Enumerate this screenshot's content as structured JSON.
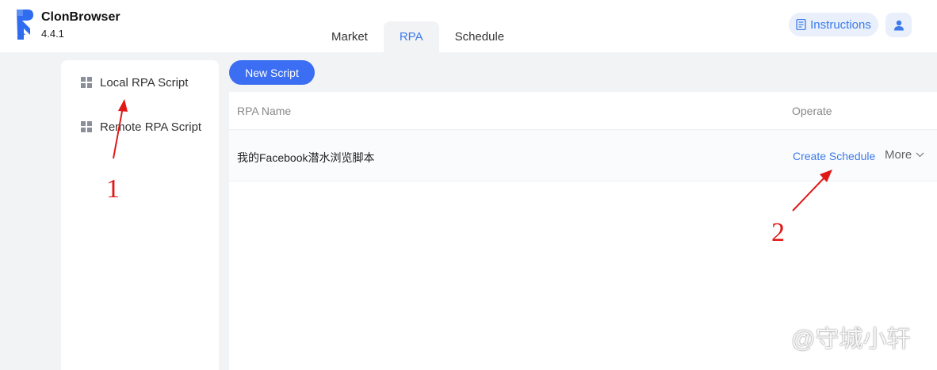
{
  "app": {
    "name": "ClonBrowser",
    "version": "4.4.1"
  },
  "tabs": [
    {
      "label": "Market",
      "active": false
    },
    {
      "label": "RPA",
      "active": true
    },
    {
      "label": "Schedule",
      "active": false
    }
  ],
  "header_actions": {
    "instructions_label": "Instructions",
    "instructions_icon": "document-icon",
    "user_icon": "user-icon"
  },
  "sidebar": {
    "items": [
      {
        "label": "Local RPA Script",
        "icon": "grid-icon"
      },
      {
        "label": "Remote RPA Script",
        "icon": "grid-icon"
      }
    ]
  },
  "toolbar": {
    "new_script_label": "New Script"
  },
  "table": {
    "columns": [
      "RPA Name",
      "Operate"
    ],
    "rows": [
      {
        "name": "我的Facebook潜水浏览脚本",
        "create_schedule_label": "Create Schedule",
        "more_label": "More"
      }
    ]
  },
  "annotations": {
    "marker_1": "1",
    "marker_2": "2",
    "color": "#e01818"
  },
  "watermark": {
    "text": "@守城小轩"
  },
  "colors": {
    "accent": "#3c7bea",
    "primary_button": "#3b6ef2",
    "background": "#f2f3f5"
  }
}
